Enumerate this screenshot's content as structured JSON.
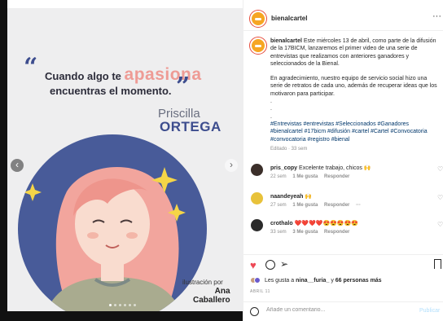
{
  "post": {
    "quote_pre": "Cuando algo te",
    "quote_accent": "apasiona",
    "quote_line2": "encuentras el momento.",
    "name_first": "Priscilla",
    "name_last": "ORTEGA",
    "credit_label": "ilustración por",
    "credit_name_1": "Ana",
    "credit_name_2": "Caballero",
    "carousel_prev": "‹",
    "carousel_next": "›"
  },
  "header": {
    "username": "bienalcartel",
    "more": "···"
  },
  "caption": {
    "username": "bienalcartel",
    "text": "Este miércoles 13 de abril, como parte de la difusión de la 17BICM, lanzaremos el primer video de una serie de entrevistas que realizamos con anteriores ganadores y seleccionados de la Bienal.",
    "text2": "En agradecimiento, nuestro equipo de servicio social hizo una serie de retratos de cada uno, además de recuperar ideas que los motivaron para participar.",
    "dots": [
      ".",
      ".",
      "."
    ],
    "hashtags": "#Entrevistas #entrevistas #Seleccionados #Ganadores #bienalcartel #17bicm #difusión #cartel #Cartel #Convocatoria #convocatoria #registro #bienal",
    "meta": "Editado · 33 sem"
  },
  "comments": [
    {
      "user": "pris_copy",
      "text": "Excelente trabajo, chicos 🙌",
      "time": "22 sem",
      "likes": "1 Me gusta",
      "reply": "Responder",
      "more": ""
    },
    {
      "user": "naandeyeah",
      "text": "🙌",
      "time": "27 sem",
      "likes": "1 Me gusta",
      "reply": "Responder",
      "more": "···"
    },
    {
      "user": "crothalo",
      "text": "❤️❤️❤️❤️😍😍😍😍😍",
      "time": "33 sem",
      "likes": "3 Me gusta",
      "reply": "Responder",
      "more": ""
    }
  ],
  "actions": {
    "like_icon": "heart-icon",
    "comment_icon": "comment-icon",
    "share_icon": "share-icon",
    "save_icon": "bookmark-icon"
  },
  "likes": {
    "prefix": "Les gusta a",
    "user": "nina__furia_",
    "middle": "y",
    "count": "66 personas más"
  },
  "date": "ABRIL 11",
  "add_comment": {
    "placeholder": "Añade un comentario...",
    "publish": "Publicar"
  },
  "colors": {
    "accent_pink": "#ee9b95",
    "navy": "#3d4d8e",
    "like_red": "#ed4956",
    "hashtag_blue": "#00376b",
    "publish_disabled": "#b2dffc"
  }
}
